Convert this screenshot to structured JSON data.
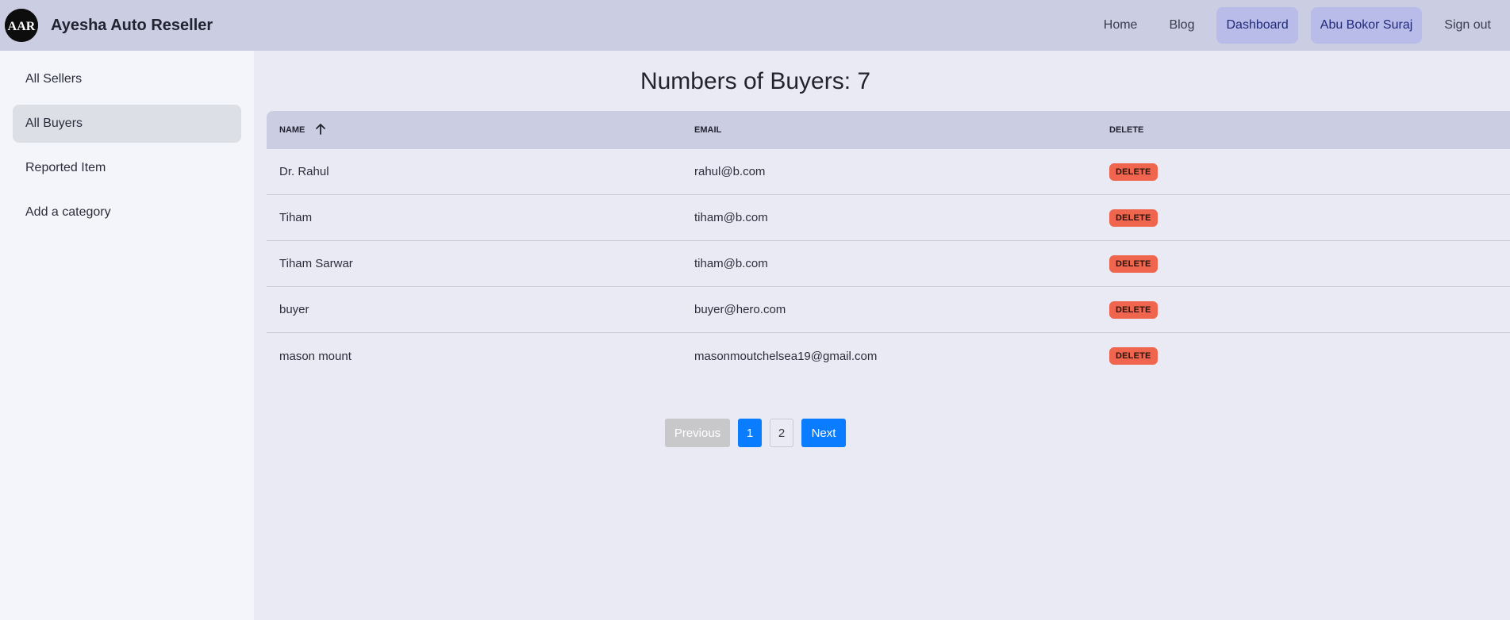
{
  "brand": {
    "name": "Ayesha Auto Reseller",
    "logo_text": "AAR",
    "icon": "brand-logo-icon"
  },
  "nav": {
    "items": [
      {
        "label": "Home",
        "active": false
      },
      {
        "label": "Blog",
        "active": false
      },
      {
        "label": "Dashboard",
        "active": true
      },
      {
        "label": "Abu Bokor Suraj",
        "active": true
      },
      {
        "label": "Sign out",
        "active": false
      }
    ]
  },
  "sidebar": {
    "items": [
      {
        "label": "All Sellers",
        "active": false
      },
      {
        "label": "All Buyers",
        "active": true
      },
      {
        "label": "Reported Item",
        "active": false
      },
      {
        "label": "Add a category",
        "active": false
      }
    ]
  },
  "main": {
    "title": "Numbers of Buyers: 7",
    "table": {
      "headers": [
        "NAME",
        "EMAIL",
        "DELETE"
      ],
      "sort_icon": "arrow-up-icon",
      "rows": [
        {
          "name": "Dr. Rahul",
          "email": "rahul@b.com",
          "action": "DELETE"
        },
        {
          "name": "Tiham",
          "email": "tiham@b.com",
          "action": "DELETE"
        },
        {
          "name": "Tiham Sarwar",
          "email": "tiham@b.com",
          "action": "DELETE"
        },
        {
          "name": "buyer",
          "email": "buyer@hero.com",
          "action": "DELETE"
        },
        {
          "name": "mason mount",
          "email": "masonmoutchelsea19@gmail.com",
          "action": "DELETE"
        }
      ]
    },
    "pagination": {
      "previous": "Previous",
      "pages": [
        "1",
        "2"
      ],
      "current": "1",
      "next": "Next"
    }
  },
  "colors": {
    "navbar": "#cbcde3",
    "nav_active": "#b9bbe9",
    "delete": "#f0654e",
    "primary": "#0a7cff"
  }
}
